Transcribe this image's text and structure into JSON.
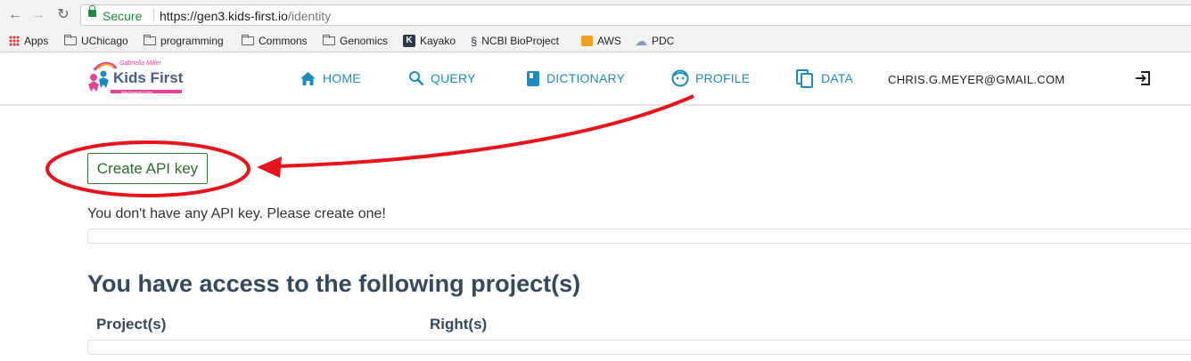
{
  "browser": {
    "secure_label": "Secure",
    "url_host": "https://gen3.kids-first.io",
    "url_path": "/identity",
    "bookmarks": [
      {
        "label": "Apps",
        "icon": "apps-grid-icon"
      },
      {
        "label": "UChicago",
        "icon": "folder-icon"
      },
      {
        "label": "programming",
        "icon": "folder-icon"
      },
      {
        "label": "Commons",
        "icon": "folder-icon"
      },
      {
        "label": "Genomics",
        "icon": "folder-icon"
      },
      {
        "label": "Kayako",
        "icon": "kayako-icon"
      },
      {
        "label": "NCBI BioProject",
        "icon": "ncbi-icon"
      },
      {
        "label": "AWS",
        "icon": "aws-icon"
      },
      {
        "label": "PDC",
        "icon": "cloud-icon"
      }
    ]
  },
  "header": {
    "logo_text": "Kids First",
    "logo_top_text": "Gabriella Miller",
    "logo_sub_text": "Data Resource Center",
    "nav": [
      {
        "label": "HOME",
        "icon": "home-icon"
      },
      {
        "label": "QUERY",
        "icon": "search-icon"
      },
      {
        "label": "DICTIONARY",
        "icon": "book-icon"
      },
      {
        "label": "PROFILE",
        "icon": "face-icon"
      },
      {
        "label": "DATA",
        "icon": "files-icon"
      }
    ],
    "user_email": "CHRIS.G.MEYER@GMAIL.COM",
    "logout_icon": "logout-icon"
  },
  "main": {
    "create_button": "Create API key",
    "no_key_message": "You don't have any API key. Please create one!",
    "access_heading": "You have access to the following project(s)",
    "columns": [
      "Project(s)",
      "Right(s)"
    ]
  },
  "colors": {
    "accent": "#1a8dbd",
    "button_border": "#2e7d32",
    "heading": "#34495e",
    "annotation": "#e8141c"
  }
}
